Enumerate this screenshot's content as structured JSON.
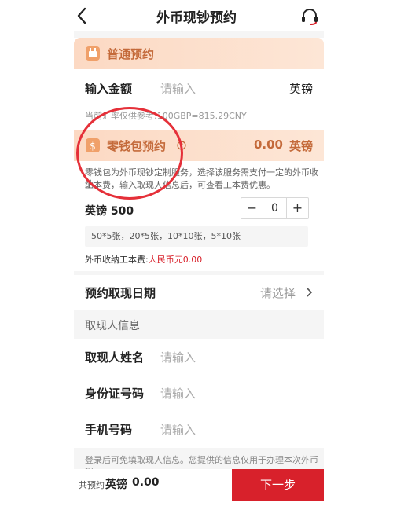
{
  "header": {
    "title": "外币现钞预约"
  },
  "normal": {
    "title": "普通预约",
    "amount_label": "输入金额",
    "amount_placeholder": "请输入",
    "currency": "英镑",
    "rate_note": "当前汇率仅供参考:100GBP=815.29CNY"
  },
  "change": {
    "title": "零钱包预约",
    "help_icon": "question-icon",
    "total": "0.00",
    "currency": "英镑",
    "desc_line1": "零钱包为外币现钞定制服务，选择该服务需支付一定的外币收纳",
    "desc_line2": "工本费，输入取现人信息后，可查看工本费优惠。",
    "pack_label": "英镑 500",
    "qty": "0",
    "minus": "−",
    "plus": "+",
    "denominations": "50*5张，20*5张，10*10张，5*10张",
    "fee_label": "外币收纳工本费:",
    "fee_value": "人民币元0.00"
  },
  "date": {
    "label": "预约取现日期",
    "placeholder": "请选择"
  },
  "person": {
    "section_title": "取现人信息",
    "name_label": "取现人姓名",
    "id_label": "身份证号码",
    "phone_label": "手机号码",
    "placeholder": "请输入",
    "footnote": "登录后可免填取现人信息。您提供的信息仅用于办理本次外币现"
  },
  "footer": {
    "prefix": "共预约",
    "currency": "英镑",
    "amount": "0.00",
    "next_label": "下一步"
  },
  "colors": {
    "accent": "#d8212b",
    "header_text": "#c46a3a",
    "fee_red": "#d8212b"
  }
}
